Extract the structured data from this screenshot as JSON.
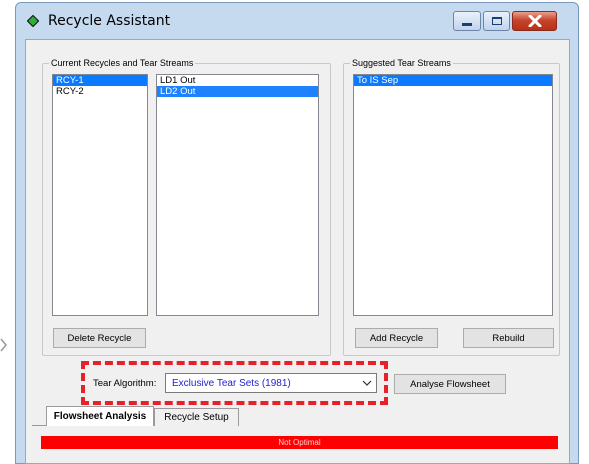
{
  "window": {
    "title": "Recycle Assistant"
  },
  "groups": {
    "current": {
      "title": "Current Recycles and Tear Streams",
      "recycles": [
        "RCY-1",
        "RCY-2"
      ],
      "streams": [
        "LD1 Out",
        "LD2 Out"
      ],
      "delete_label": "Delete Recycle"
    },
    "suggested": {
      "title": "Suggested Tear Streams",
      "items": [
        "To IS Sep"
      ],
      "add_label": "Add Recycle",
      "rebuild_label": "Rebuild"
    }
  },
  "tear": {
    "label": "Tear Algorithm:",
    "selected": "Exclusive Tear Sets (1981)",
    "analyse_label": "Analyse Flowsheet"
  },
  "tabs": [
    "Flowsheet Analysis",
    "Recycle Setup"
  ],
  "status": {
    "text": "Not Optimal",
    "color": "#ff0000"
  },
  "colors": {
    "selection": "#0a7aff",
    "highlight_border": "#e8202a",
    "combo_text": "#2222cc"
  }
}
